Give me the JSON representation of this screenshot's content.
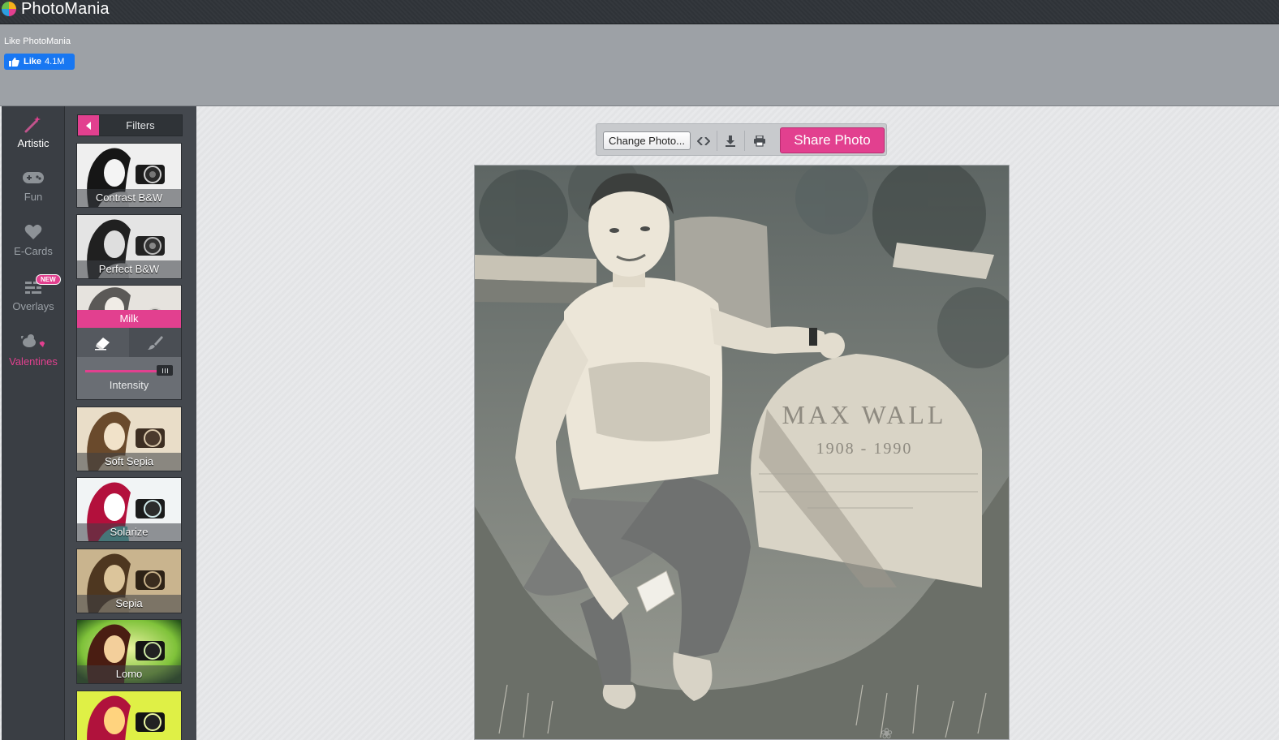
{
  "app": {
    "title": "PhotoMania"
  },
  "like_box": {
    "title": "Like PhotoMania",
    "button_label": "Like",
    "count": "4.1M"
  },
  "rail": {
    "items": [
      {
        "label": "Artistic",
        "icon": "magic-wand-icon",
        "state": "active"
      },
      {
        "label": "Fun",
        "icon": "gamepad-icon",
        "state": "normal"
      },
      {
        "label": "E-Cards",
        "icon": "heart-icon",
        "state": "normal"
      },
      {
        "label": "Overlays",
        "icon": "overlays-icon",
        "state": "normal",
        "badge": "NEW"
      },
      {
        "label": "Valentines",
        "icon": "cupid-icon",
        "state": "highlight"
      }
    ]
  },
  "filters": {
    "title": "Filters",
    "items": [
      {
        "label": "Contrast B&W"
      },
      {
        "label": "Perfect B&W"
      },
      {
        "label": "Milk",
        "selected": true
      },
      {
        "label": "Soft Sepia"
      },
      {
        "label": "Solarize"
      },
      {
        "label": "Sepia"
      },
      {
        "label": "Lomo"
      }
    ],
    "intensity_label": "Intensity",
    "intensity_value": 1.0
  },
  "toolbar": {
    "change_label": "Change Photo...",
    "share_label": "Share Photo"
  },
  "photo": {
    "stone_name": "MAX WALL",
    "stone_years": "1908 - 1990"
  },
  "colors": {
    "accent": "#e2408f",
    "rail_bg": "#3a3e44",
    "panel_bg": "#44484e"
  }
}
